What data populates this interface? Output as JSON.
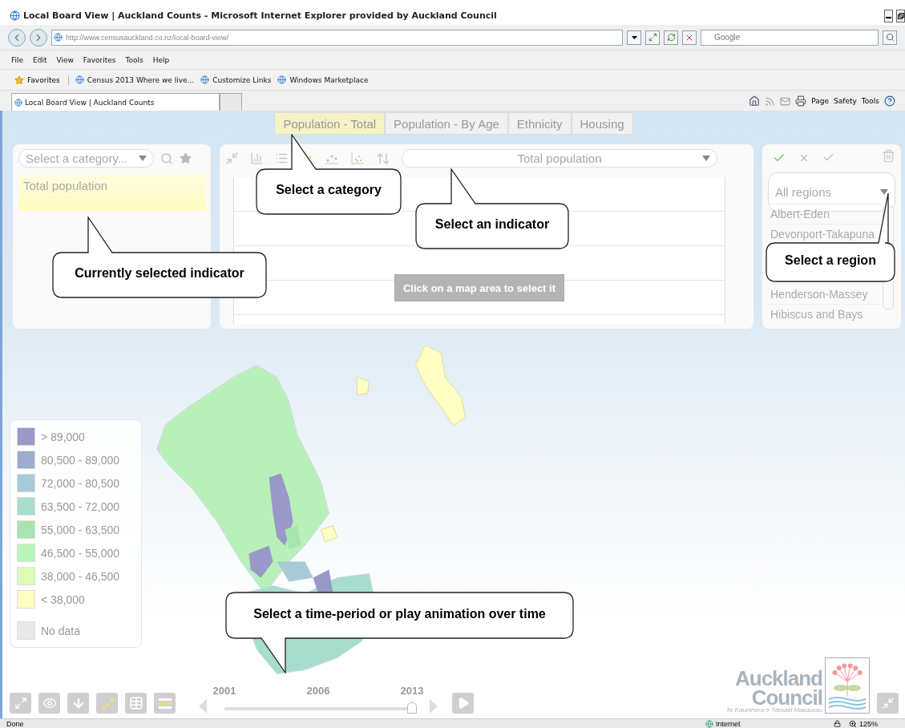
{
  "window": {
    "title": "Local Board View | Auckland Counts - Microsoft Internet Explorer provided by Auckland Council"
  },
  "address_bar": {
    "url": "http://www.censusauckland.co.nz/local-board-view/"
  },
  "search": {
    "placeholder": "Google"
  },
  "menu": [
    "File",
    "Edit",
    "View",
    "Favorites",
    "Tools",
    "Help"
  ],
  "favorites_bar": {
    "label": "Favorites",
    "links": [
      "Census 2013 Where we live...",
      "Customize Links",
      "Windows Marketplace"
    ]
  },
  "browser_tabs": [
    {
      "label": "Local Board View | Auckland Counts",
      "selected": true
    }
  ],
  "command_bar": [
    "Page",
    "Safety",
    "Tools"
  ],
  "page": {
    "tabs": [
      {
        "label": "Population - Total",
        "selected": true
      },
      {
        "label": "Population - By Age",
        "selected": false
      },
      {
        "label": "Ethnicity",
        "selected": false
      },
      {
        "label": "Housing",
        "selected": false
      }
    ],
    "category_panel": {
      "placeholder": "Select a category...",
      "selected_indicator": "Total population"
    },
    "chart_panel": {
      "tools": [
        {
          "kind": "expand",
          "selected": false
        },
        {
          "kind": "bar",
          "selected": false
        },
        {
          "kind": "table",
          "selected": false
        },
        {
          "kind": "line",
          "selected": true
        },
        {
          "kind": "dots",
          "selected": false
        },
        {
          "kind": "scatter",
          "selected": false
        },
        {
          "kind": "sort",
          "selected": false
        }
      ],
      "indicator": "Total population",
      "hint": "Click on a map area to select it"
    },
    "region_panel": {
      "dropdown": "All regions",
      "regions": [
        "Albert-Eden",
        "Devonport-Takapuna",
        "Henderson-Massey",
        "Hibiscus and Bays"
      ]
    },
    "legend": [
      {
        "label": "> 89,000",
        "color": "#9a98c8"
      },
      {
        "label": "80,500 - 89,000",
        "color": "#9eaad0"
      },
      {
        "label": "72,000 - 80,500",
        "color": "#a6cad8"
      },
      {
        "label": "63,500 - 72,000",
        "color": "#a8dccc"
      },
      {
        "label": "55,000 - 63,500",
        "color": "#a8e4b0"
      },
      {
        "label": "46,500 - 55,000",
        "color": "#b9f4b9"
      },
      {
        "label": "38,000 - 46,500",
        "color": "#ddfcb8"
      },
      {
        "label": "< 38,000",
        "color": "#ffffc4"
      },
      {
        "label": "No data",
        "color": "#e8e8e8"
      }
    ],
    "timeline": {
      "labels": [
        "2001",
        "2006",
        "2013"
      ],
      "level": 1
    },
    "logo": {
      "line1": "Auckland",
      "line2": "Council",
      "tagline": "Te Kaunihera o Tāmaki Makaurau"
    }
  },
  "callouts": [
    "Select a category",
    "Select an indicator",
    "Currently selected indicator",
    "Select a region",
    "Select a time-period or play animation over time"
  ],
  "status_bar": {
    "text": "Done",
    "zone": "Internet",
    "zoom": "125%"
  }
}
